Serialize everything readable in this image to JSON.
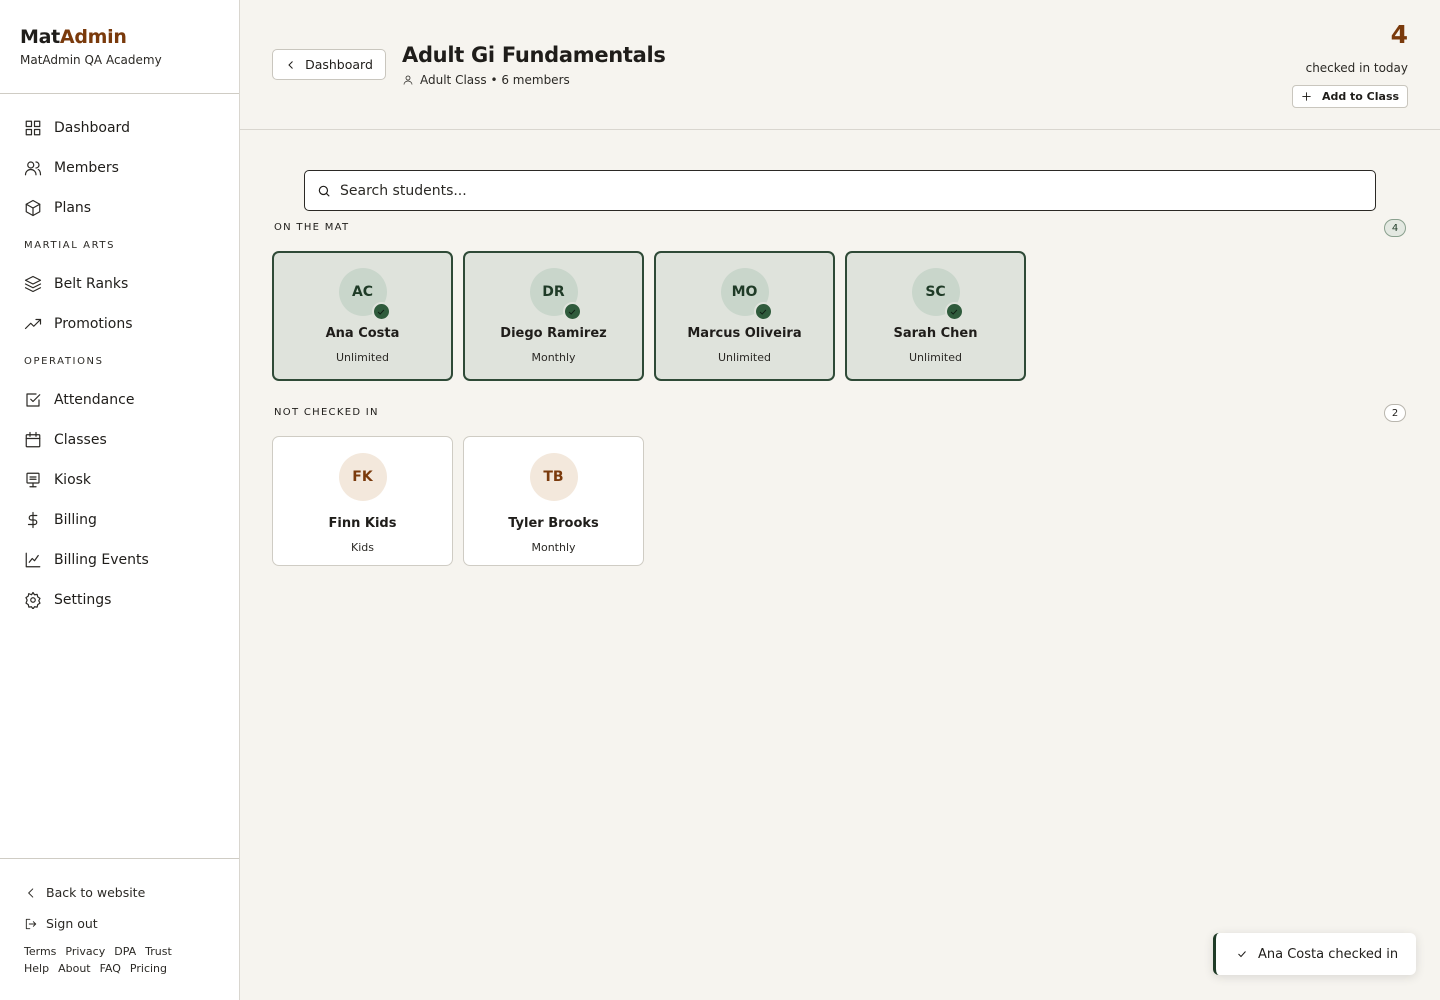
{
  "brand": {
    "name_part1": "Mat",
    "name_part2": "Admin",
    "academy": "MatAdmin QA Academy"
  },
  "sidebar": {
    "primary": [
      {
        "label": "Dashboard",
        "icon": "grid-icon"
      },
      {
        "label": "Members",
        "icon": "users-icon"
      },
      {
        "label": "Plans",
        "icon": "box-icon"
      }
    ],
    "section_martial_arts": "MARTIAL ARTS",
    "martial_arts": [
      {
        "label": "Belt Ranks",
        "icon": "layers-icon"
      },
      {
        "label": "Promotions",
        "icon": "trending-up-icon"
      }
    ],
    "section_operations": "OPERATIONS",
    "operations": [
      {
        "label": "Attendance",
        "icon": "check-square-icon"
      },
      {
        "label": "Classes",
        "icon": "calendar-icon"
      },
      {
        "label": "Kiosk",
        "icon": "kiosk-icon"
      },
      {
        "label": "Billing",
        "icon": "dollar-icon"
      },
      {
        "label": "Billing Events",
        "icon": "chart-icon"
      },
      {
        "label": "Settings",
        "icon": "gear-icon"
      }
    ],
    "back_to_website": "Back to website",
    "sign_out": "Sign out",
    "footer_links": [
      "Terms",
      "Privacy",
      "DPA",
      "Trust",
      "Help",
      "About",
      "FAQ",
      "Pricing"
    ]
  },
  "header": {
    "back_label": "Dashboard",
    "title": "Adult Gi Fundamentals",
    "meta": "Adult Class • 6 members",
    "checked_in_count": "4",
    "checked_in_label": "checked in today",
    "add_label": "Add to Class"
  },
  "search": {
    "placeholder": "Search students..."
  },
  "on_mat": {
    "label": "ON THE MAT",
    "count": "4",
    "students": [
      {
        "initials": "AC",
        "name": "Ana Costa",
        "plan": "Unlimited"
      },
      {
        "initials": "DR",
        "name": "Diego Ramirez",
        "plan": "Monthly"
      },
      {
        "initials": "MO",
        "name": "Marcus Oliveira",
        "plan": "Unlimited"
      },
      {
        "initials": "SC",
        "name": "Sarah Chen",
        "plan": "Unlimited"
      }
    ]
  },
  "not_checked": {
    "label": "NOT CHECKED IN",
    "count": "2",
    "students": [
      {
        "initials": "FK",
        "name": "Finn Kids",
        "plan": "Kids"
      },
      {
        "initials": "TB",
        "name": "Tyler Brooks",
        "plan": "Monthly"
      }
    ]
  },
  "toast": {
    "message": "Ana Costa checked in"
  },
  "colors": {
    "brand_accent": "#7a3a0c",
    "checked_green": "#2f5b3c",
    "card_green_bg": "#dfe3dc",
    "page_bg": "#f6f4ef"
  }
}
